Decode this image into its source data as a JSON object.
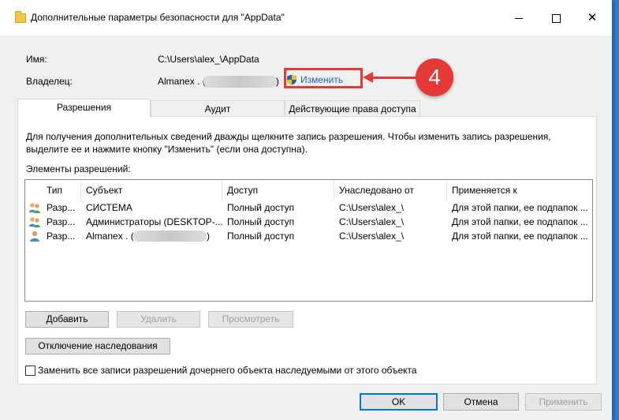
{
  "window": {
    "title": "Дополнительные параметры безопасности  для \"AppData\""
  },
  "info": {
    "name_label": "Имя:",
    "name_value": "C:\\Users\\alex_\\AppData",
    "owner_label": "Владелец:",
    "owner_value_prefix": "Almanex . (",
    "owner_value_suffix": ")",
    "change_link": "Изменить"
  },
  "annotation": {
    "step_number": "4",
    "color": "#e53935"
  },
  "tabs": [
    {
      "label": "Разрешения",
      "active": true
    },
    {
      "label": "Аудит",
      "active": false
    },
    {
      "label": "Действующие права доступа",
      "active": false
    }
  ],
  "permissions": {
    "description": "Для получения дополнительных сведений дважды щелкните запись разрешения. Чтобы изменить запись разрешения, выделите ее и нажмите кнопку \"Изменить\" (если она доступна).",
    "list_label": "Элементы разрешений:",
    "columns": [
      "Тип",
      "Субъект",
      "Доступ",
      "Унаследовано от",
      "Применяется к"
    ],
    "rows": [
      {
        "type": "Разр...",
        "subject": "СИСТЕМА",
        "access": "Полный доступ",
        "inherited": "C:\\Users\\alex_\\",
        "applies": "Для этой папки, ее подпапок ..."
      },
      {
        "type": "Разр...",
        "subject": "Администраторы (DESKTOP-...",
        "access": "Полный доступ",
        "inherited": "C:\\Users\\alex_\\",
        "applies": "Для этой папки, ее подпапок ..."
      },
      {
        "type": "Разр...",
        "subject": "Almanex . (",
        "subject_suffix": ")",
        "access": "Полный доступ",
        "inherited": "C:\\Users\\alex_\\",
        "applies": "Для этой папки, ее подпапок ..."
      }
    ],
    "buttons": {
      "add": "Добавить",
      "remove": "Удалить",
      "view": "Просмотреть",
      "disable_inheritance": "Отключение наследования"
    },
    "replace_checkbox": {
      "label": "Заменить все записи разрешений дочернего объекта наследуемыми от этого объекта",
      "checked": false
    }
  },
  "footer": {
    "ok": "OK",
    "cancel": "Отмена",
    "apply": "Применить"
  }
}
